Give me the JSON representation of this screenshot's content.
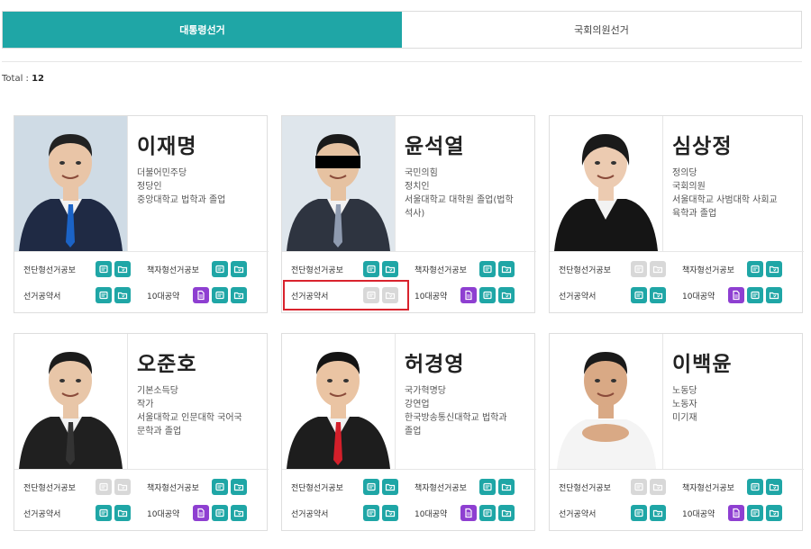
{
  "tabs": [
    {
      "label": "대통령선거",
      "active": true
    },
    {
      "label": "국회의원선거",
      "active": false
    }
  ],
  "total": {
    "label": "Total :",
    "count": "12"
  },
  "doc_labels": {
    "short_pledge": "전단형선거공보",
    "booklet_pledge": "책자형선거공보",
    "pledge_book": "선거공약서",
    "top10": "10대공약"
  },
  "colors": {
    "accent": "#1fa6a6",
    "purple": "#8e3fd1",
    "disabled": "#d8d8d8",
    "highlight": "#d9232d"
  },
  "candidates": [
    {
      "name": "이재명",
      "lines": [
        "더불어민주당",
        "정당인",
        "중앙대학교 법학과 졸업"
      ],
      "short_pledge_enabled": true,
      "booklet_enabled": true,
      "pledge_book_enabled": true
    },
    {
      "name": "윤석열",
      "lines": [
        "국민의힘",
        "정치인",
        "서울대학교 대학원 졸업(법학",
        "석사)"
      ],
      "short_pledge_enabled": true,
      "booklet_enabled": true,
      "pledge_book_enabled": false
    },
    {
      "name": "심상정",
      "lines": [
        "정의당",
        "국회의원",
        "서울대학교 사범대학 사회교",
        "육학과 졸업"
      ],
      "short_pledge_enabled": false,
      "booklet_enabled": true,
      "pledge_book_enabled": true
    },
    {
      "name": "오준호",
      "lines": [
        "기본소득당",
        "작가",
        "서울대학교 인문대학 국어국",
        "문학과 졸업"
      ],
      "short_pledge_enabled": false,
      "booklet_enabled": true,
      "pledge_book_enabled": true
    },
    {
      "name": "허경영",
      "lines": [
        "국가혁명당",
        "강연업",
        "한국방송통신대학교 법학과",
        "졸업"
      ],
      "short_pledge_enabled": true,
      "booklet_enabled": true,
      "pledge_book_enabled": true
    },
    {
      "name": "이백윤",
      "lines": [
        "노동당",
        "노동자",
        "미기재"
      ],
      "short_pledge_enabled": false,
      "booklet_enabled": true,
      "pledge_book_enabled": true
    }
  ]
}
